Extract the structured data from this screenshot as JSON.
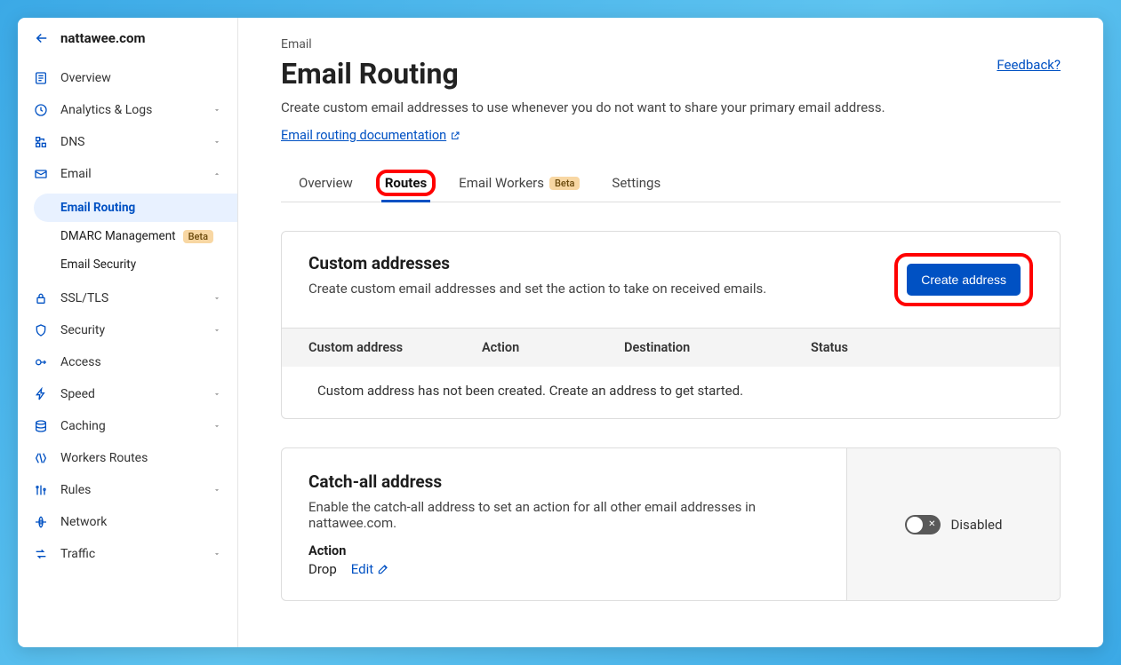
{
  "header": {
    "domain": "nattawee.com"
  },
  "sidebar": {
    "items": [
      {
        "label": "Overview",
        "icon": "overview"
      },
      {
        "label": "Analytics & Logs",
        "icon": "analytics",
        "chevron": true
      },
      {
        "label": "DNS",
        "icon": "dns",
        "chevron": true
      },
      {
        "label": "Email",
        "icon": "email",
        "expanded": true,
        "sub": [
          {
            "label": "Email Routing",
            "active": true
          },
          {
            "label": "DMARC Management",
            "beta": true
          },
          {
            "label": "Email Security"
          }
        ]
      },
      {
        "label": "SSL/TLS",
        "icon": "lock",
        "chevron": true
      },
      {
        "label": "Security",
        "icon": "shield",
        "chevron": true
      },
      {
        "label": "Access",
        "icon": "access"
      },
      {
        "label": "Speed",
        "icon": "bolt",
        "chevron": true
      },
      {
        "label": "Caching",
        "icon": "cache",
        "chevron": true
      },
      {
        "label": "Workers Routes",
        "icon": "workers"
      },
      {
        "label": "Rules",
        "icon": "rules",
        "chevron": true
      },
      {
        "label": "Network",
        "icon": "network"
      },
      {
        "label": "Traffic",
        "icon": "traffic",
        "chevron": true
      }
    ],
    "beta_badge": "Beta"
  },
  "page": {
    "breadcrumb": "Email",
    "title": "Email Routing",
    "feedback": "Feedback?",
    "description": "Create custom email addresses to use whenever you do not want to share your primary email address.",
    "doc_link": "Email routing documentation"
  },
  "tabs": [
    {
      "label": "Overview"
    },
    {
      "label": "Routes",
      "active": true,
      "highlight": true
    },
    {
      "label": "Email Workers",
      "beta": true
    },
    {
      "label": "Settings"
    }
  ],
  "custom_addresses": {
    "title": "Custom addresses",
    "desc": "Create custom email addresses and set the action to take on received emails.",
    "create_button": "Create address",
    "columns": {
      "c1": "Custom address",
      "c2": "Action",
      "c3": "Destination",
      "c4": "Status"
    },
    "empty": "Custom address has not been created. Create an address to get started."
  },
  "catchall": {
    "title": "Catch-all address",
    "desc": "Enable the catch-all address to set an action for all other email addresses in nattawee.com.",
    "action_label": "Action",
    "action_value": "Drop",
    "edit": "Edit",
    "toggle_label": "Disabled"
  }
}
